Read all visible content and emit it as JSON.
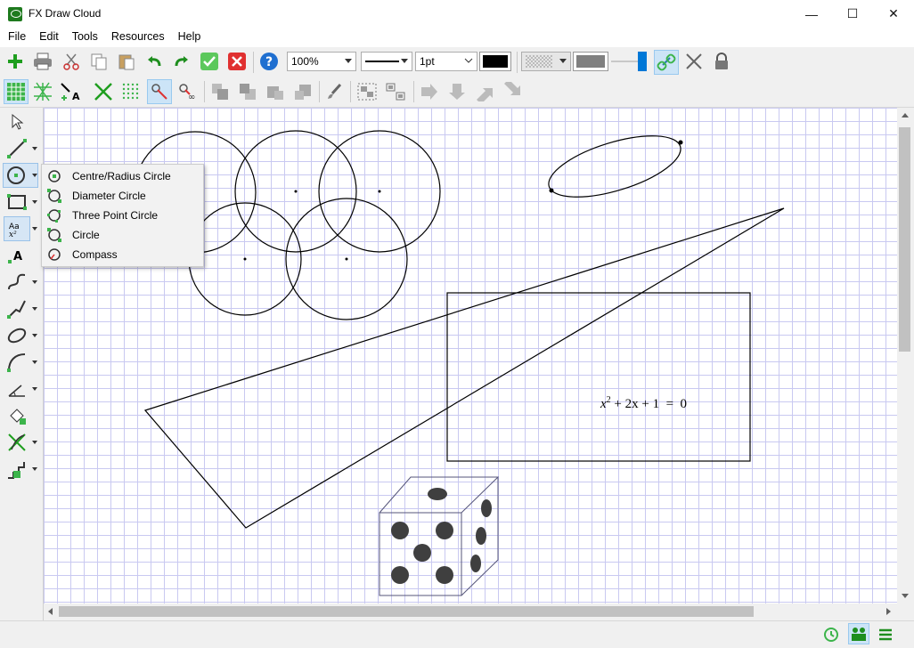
{
  "window": {
    "title": "FX Draw Cloud",
    "controls": [
      "—",
      "☐",
      "✕"
    ]
  },
  "menu": [
    "File",
    "Edit",
    "Tools",
    "Resources",
    "Help"
  ],
  "toolbar": {
    "zoom": "100%",
    "line_width": "1pt",
    "colors": {
      "line_color": "#000000",
      "fill_color": "#808080",
      "slider_color": "#0078d7",
      "accent_green": "#1e9e1e",
      "accent_red": "#e03030"
    },
    "icons_row1": [
      "add-icon",
      "print-icon",
      "cut-icon",
      "copy-icon",
      "paste-icon",
      "undo-icon",
      "redo-icon",
      "ok-icon",
      "cancel-icon",
      "help-icon"
    ],
    "icons_row2": [
      "grid-icon",
      "iso-grid-icon",
      "label-point-icon",
      "axes-icon",
      "dot-grid-icon",
      "snap-icon",
      "snap-infinity-icon",
      "arrange-icons",
      "brush-icon",
      "group-icon",
      "ungroup-icon",
      "arrow-icons"
    ]
  },
  "palette": [
    "pointer-icon",
    "line-tool-icon",
    "circle-tool-icon",
    "rectangle-tool-icon",
    "text-tool-icon",
    "label-tool-icon",
    "curve-tool-icon",
    "polyline-tool-icon",
    "ellipse-tool-icon",
    "arc-tool-icon",
    "angle-tool-icon",
    "fill-tool-icon",
    "graph-tool-icon",
    "stairs-tool-icon"
  ],
  "circle_menu": [
    {
      "label": "Centre/Radius Circle",
      "icon": "centre-radius-circle-icon"
    },
    {
      "label": "Diameter Circle",
      "icon": "diameter-circle-icon"
    },
    {
      "label": "Three Point Circle",
      "icon": "three-point-circle-icon"
    },
    {
      "label": "Circle",
      "icon": "circle-icon"
    },
    {
      "label": "Compass",
      "icon": "compass-icon"
    }
  ],
  "canvas": {
    "equation": {
      "base": "x",
      "exp": "2",
      "rest": " + 2x + 1  =  0"
    }
  }
}
